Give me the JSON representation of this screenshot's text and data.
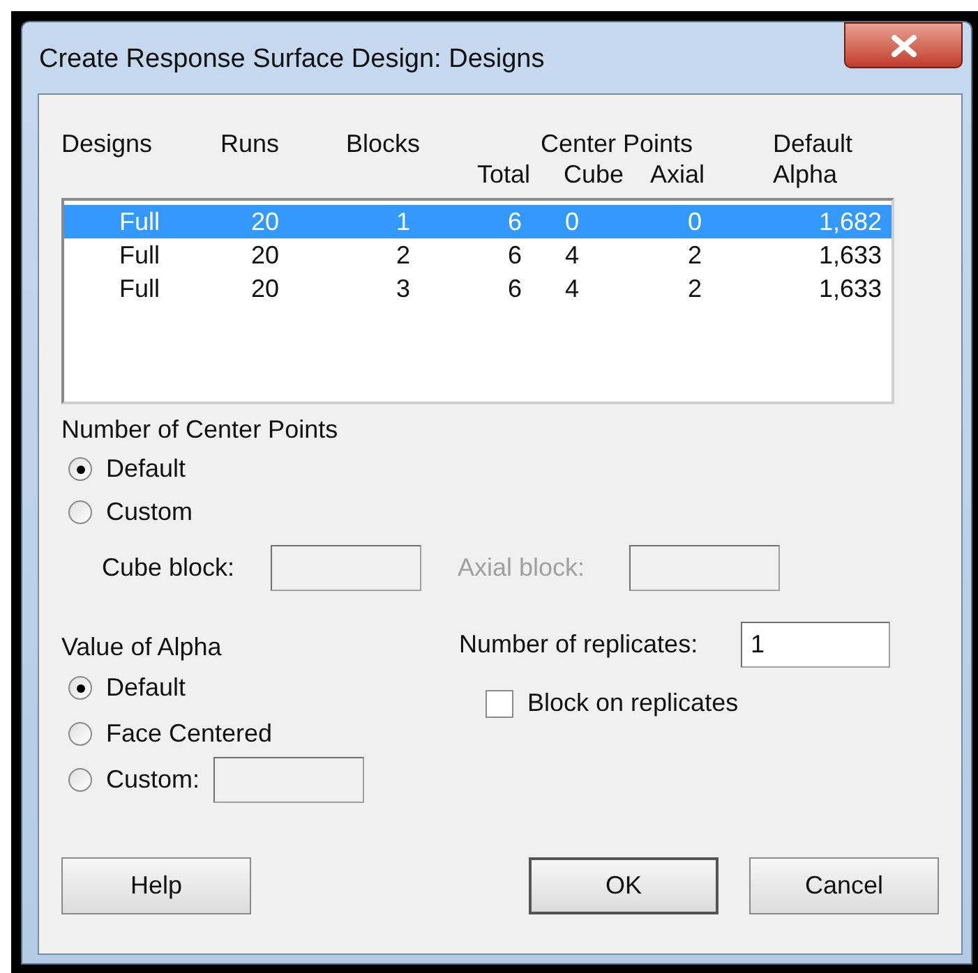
{
  "window": {
    "title": "Create Response Surface Design: Designs"
  },
  "designs_table": {
    "headers": {
      "designs": "Designs",
      "runs": "Runs",
      "blocks": "Blocks",
      "center_points": "Center Points",
      "total": "Total",
      "cube": "Cube",
      "axial": "Axial",
      "default_alpha": "Default Alpha"
    },
    "rows": [
      {
        "design": "Full",
        "runs": "20",
        "blocks": "1",
        "total": "6",
        "cube": "0",
        "axial": "0",
        "alpha": "1,682",
        "selected": true
      },
      {
        "design": "Full",
        "runs": "20",
        "blocks": "2",
        "total": "6",
        "cube": "4",
        "axial": "2",
        "alpha": "1,633",
        "selected": false
      },
      {
        "design": "Full",
        "runs": "20",
        "blocks": "3",
        "total": "6",
        "cube": "4",
        "axial": "2",
        "alpha": "1,633",
        "selected": false
      }
    ]
  },
  "center_points": {
    "label": "Number of Center Points",
    "options": [
      {
        "label": "Default",
        "selected": true
      },
      {
        "label": "Custom",
        "selected": false
      }
    ],
    "cube_block": {
      "label": "Cube block:",
      "disabled": false
    },
    "axial_block": {
      "label": "Axial block:",
      "disabled": true
    }
  },
  "alpha": {
    "label": "Value of Alpha",
    "options": [
      {
        "label": "Default",
        "selected": true,
        "kind": "plain"
      },
      {
        "label": "Face Centered",
        "selected": false,
        "kind": "plain"
      },
      {
        "label": "Custom:",
        "selected": false,
        "kind": "field"
      }
    ]
  },
  "replicates": {
    "label": "Number of replicates:",
    "value": "1"
  },
  "block_on_replicates": {
    "label": "Block on replicates",
    "checked": false
  },
  "buttons": [
    {
      "label": "Help",
      "default": false
    },
    {
      "label": "OK",
      "default": true
    },
    {
      "label": "Cancel",
      "default": false
    }
  ]
}
